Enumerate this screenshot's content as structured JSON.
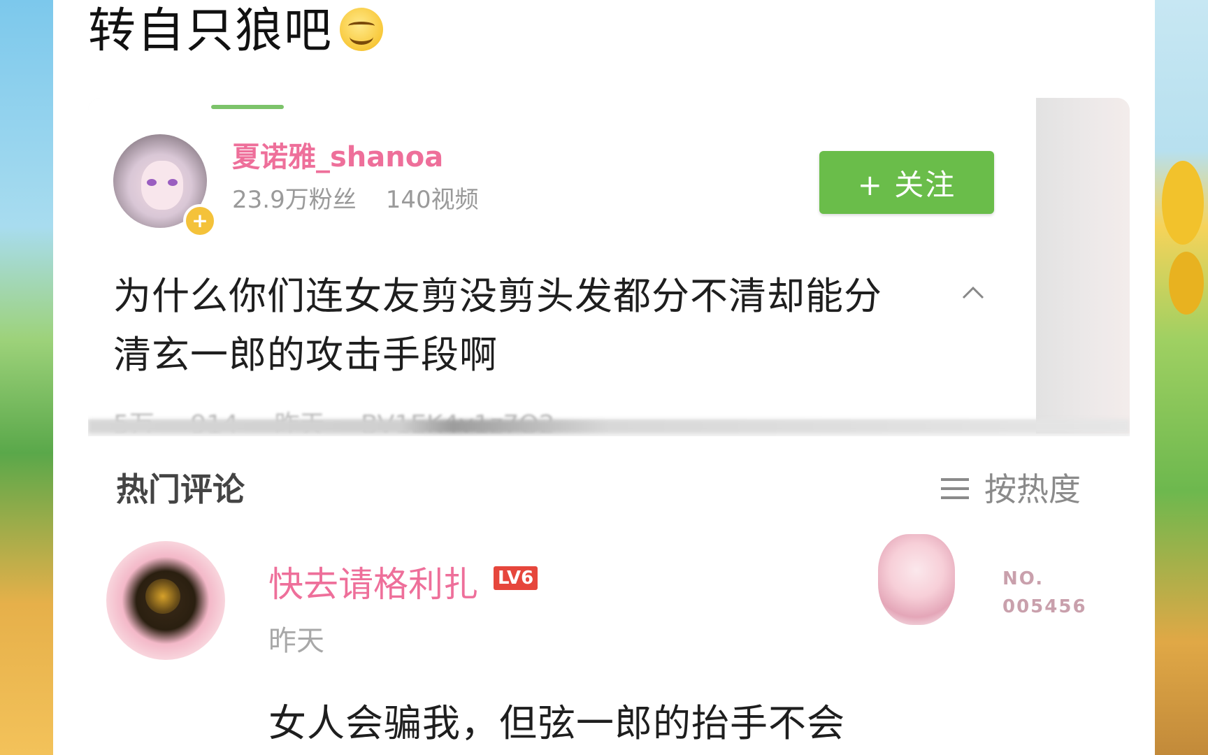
{
  "post": {
    "text": "转自只狼吧",
    "emoji": "grinning-face-emoji"
  },
  "video_card": {
    "uploader": {
      "name": "夏诺雅_shanoa",
      "fans": "23.9万粉丝",
      "videos": "140视频"
    },
    "follow_label": "+ 关注",
    "question": "为什么你们连女友剪没剪头发都分不清却能分清玄一郎的攻击手段啊",
    "stats": {
      "likes": "5万",
      "comments": "914",
      "time": "昨天",
      "bvid": "BV1EK4y1z7Q2"
    }
  },
  "comments": {
    "title": "热门评论",
    "sort_label": "按热度",
    "items": [
      {
        "user": "快去请格利扎",
        "level": "LV6",
        "time": "昨天",
        "fan_label": "NO.",
        "fan_number": "005456",
        "text": "女人会骗我，但弦一郎的抬手不会"
      }
    ]
  },
  "colors": {
    "accent_pink": "#ee6f9a",
    "follow_green": "#6abd4a",
    "level_red": "#e6463c"
  }
}
